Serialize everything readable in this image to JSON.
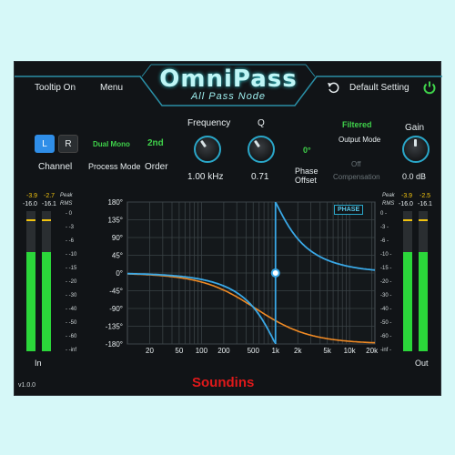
{
  "header": {
    "title": "OmniPass",
    "subtitle": "All Pass Node",
    "tooltip": "Tooltip On",
    "menu": "Menu",
    "preset": "Default Setting"
  },
  "channel": {
    "left": "L",
    "right": "R",
    "label": "Channel",
    "selected": "L"
  },
  "process_mode": {
    "value": "Dual Mono",
    "label": "Process Mode"
  },
  "order": {
    "value": "2nd",
    "label": "Order"
  },
  "frequency": {
    "label": "Frequency",
    "value": "1.00 kHz"
  },
  "q": {
    "label": "Q",
    "value": "0.71"
  },
  "phase_offset": {
    "value": "0°",
    "label_line1": "Phase",
    "label_line2": "Offset"
  },
  "output_mode": {
    "value": "Filtered",
    "label": "Output Mode"
  },
  "compensation": {
    "value": "Off",
    "label": "Compensation"
  },
  "gain": {
    "label": "Gain",
    "value": "0.0 dB"
  },
  "meters": {
    "in": {
      "label": "In",
      "peak_l": "-3.9",
      "peak_r": "-2.7",
      "rms_l": "-16.0",
      "rms_r": "-16.1",
      "peak_label": "Peak",
      "rms_label": "RMS",
      "level_l": 0.71,
      "level_r": 0.71
    },
    "out": {
      "label": "Out",
      "peak_l": "-3.9",
      "peak_r": "-2.5",
      "rms_l": "-16.0",
      "rms_r": "-16.1",
      "peak_label": "Peak",
      "rms_label": "RMS",
      "level_l": 0.71,
      "level_r": 0.71
    },
    "scale": [
      "0",
      "-3",
      "-6",
      "-10",
      "-15",
      "-20",
      "-30",
      "-40",
      "-50",
      "-60",
      "-inf"
    ]
  },
  "graph": {
    "tag": "PHASE",
    "y_ticks": [
      "180°",
      "135°",
      "90°",
      "45°",
      "0°",
      "-45°",
      "-90°",
      "-135°",
      "-180°"
    ],
    "x_ticks": [
      "20",
      "50",
      "100",
      "200",
      "500",
      "1k",
      "2k",
      "5k",
      "10k",
      "20k"
    ],
    "colors": {
      "phase": "#3aa8e6",
      "group_delay": "#f08a24"
    }
  },
  "footer": {
    "version": "v1.0.0",
    "brand": "Soundins"
  }
}
